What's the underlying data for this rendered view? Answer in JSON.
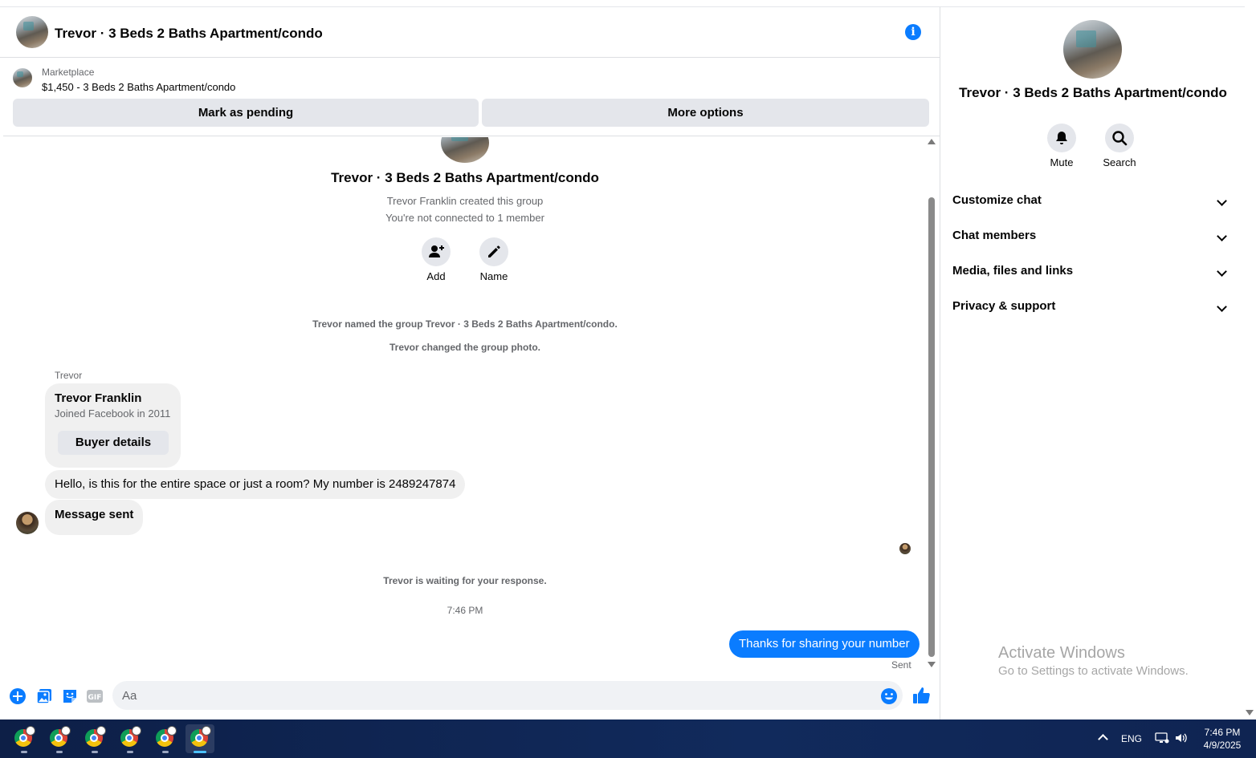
{
  "header": {
    "title": "Trevor · 3 Beds 2 Baths Apartment/condo"
  },
  "marketplace": {
    "label": "Marketplace",
    "item": "$1,450 - 3 Beds 2 Baths Apartment/condo",
    "pending_button": "Mark as pending",
    "options_button": "More options"
  },
  "conversation": {
    "group_title": "Trevor · 3 Beds 2 Baths Apartment/condo",
    "created_note": "Trevor Franklin created this group",
    "connected_note": "You're not connected to 1 member",
    "add_label": "Add",
    "name_label": "Name",
    "named_note": "Trevor named the group Trevor · 3 Beds 2 Baths Apartment/condo.",
    "photo_note": "Trevor changed the group photo.",
    "sender_name": "Trevor",
    "card": {
      "name": "Trevor Franklin",
      "joined": "Joined Facebook in 2011",
      "button": "Buyer details"
    },
    "incoming": [
      "Hello, is this for the entire space or just a room? My number is 2489247874",
      "Message sent"
    ],
    "waiting_note": "Trevor is waiting for your response.",
    "time": "7:46 PM",
    "outgoing": "Thanks for sharing your number",
    "sent_label": "Sent"
  },
  "composer": {
    "placeholder": "Aa"
  },
  "details": {
    "title": "Trevor · 3 Beds 2 Baths Apartment/condo",
    "mute_label": "Mute",
    "search_label": "Search",
    "sections": [
      "Customize chat",
      "Chat members",
      "Media, files and links",
      "Privacy & support"
    ]
  },
  "watermark": {
    "title": "Activate Windows",
    "subtitle": "Go to Settings to activate Windows."
  },
  "taskbar": {
    "language": "ENG",
    "time": "7:46 PM",
    "date": "4/9/2025"
  },
  "colors": {
    "accent": "#0a7cff",
    "bubble_in": "#f0f0f0",
    "taskbar": "#112a5c"
  }
}
